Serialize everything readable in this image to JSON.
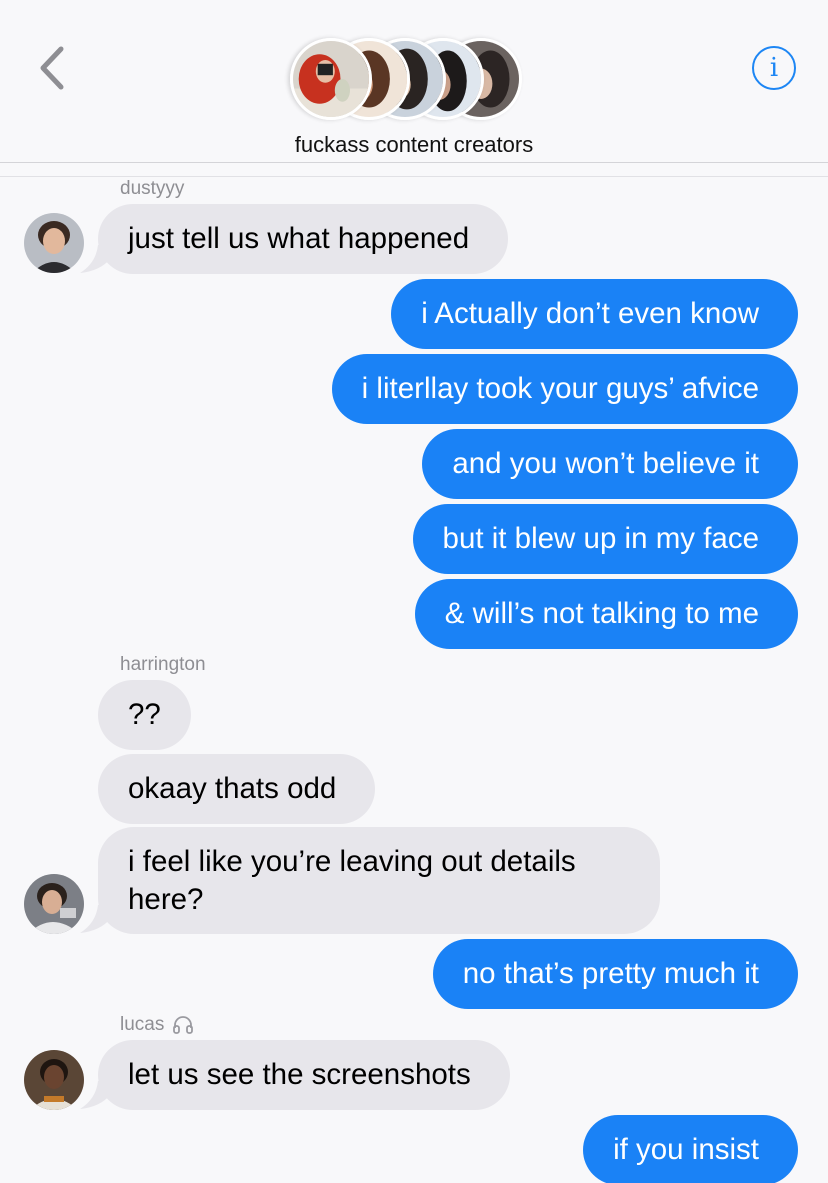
{
  "header": {
    "group_name": "fuckass content creators",
    "back_icon": "chevron-left-icon",
    "info_icon": "info-icon",
    "info_glyph": "i",
    "accent_color": "#1a82f6"
  },
  "messages": [
    {
      "sender": "dustyyy",
      "direction": "incoming",
      "text": "just tell us what happened"
    },
    {
      "direction": "outgoing",
      "text": "i Actually don’t even know"
    },
    {
      "direction": "outgoing",
      "text": "i literllay took your guys’ afvice"
    },
    {
      "direction": "outgoing",
      "text": "and you won’t believe it"
    },
    {
      "direction": "outgoing",
      "text": "but it blew up in my face"
    },
    {
      "direction": "outgoing",
      "text": "& will’s not talking to me"
    },
    {
      "sender": "harrington",
      "direction": "incoming",
      "text": "??"
    },
    {
      "direction": "incoming",
      "text": "okaay thats odd"
    },
    {
      "direction": "incoming",
      "text": "i feel like you’re leaving out details here?"
    },
    {
      "direction": "outgoing",
      "text": "no that’s pretty much it"
    },
    {
      "sender": "lucas",
      "sender_icon": "headphones-icon",
      "direction": "incoming",
      "text": "let us see the screenshots"
    },
    {
      "direction": "outgoing",
      "text": "if you insist"
    }
  ],
  "colors": {
    "incoming_bubble": "#e7e6eb",
    "outgoing_bubble": "#1a82f6",
    "background": "#f8f8fa"
  }
}
